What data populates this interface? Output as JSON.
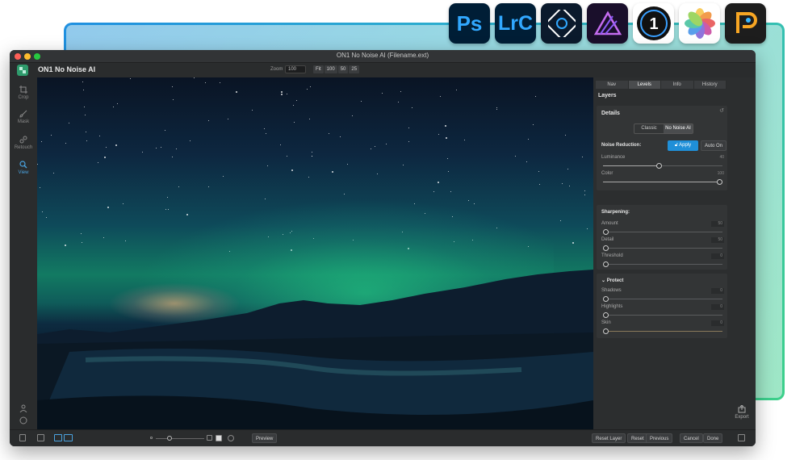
{
  "window": {
    "title": "ON1 No Noise AI (Filename.ext)",
    "app_name": "ON1 No Noise AI"
  },
  "host_apps": [
    {
      "name": "Photoshop",
      "label": "Ps"
    },
    {
      "name": "Lightroom Classic",
      "label": "LrC"
    },
    {
      "name": "Photoshop Elements",
      "label": ""
    },
    {
      "name": "Affinity Photo",
      "label": ""
    },
    {
      "name": "Capture One",
      "label": "1"
    },
    {
      "name": "Apple Photos",
      "label": ""
    },
    {
      "name": "PaintShop Pro",
      "label": ""
    }
  ],
  "toolbar": {
    "zoom_label": "Zoom",
    "zoom_value": "100",
    "zoom_buttons": [
      "Fit",
      "100",
      "50",
      "25"
    ]
  },
  "left_tools": [
    {
      "label": "Crop",
      "icon": "crop-icon"
    },
    {
      "label": "Mask",
      "icon": "brush-icon"
    },
    {
      "label": "Retouch",
      "icon": "retouch-icon"
    },
    {
      "label": "View",
      "icon": "view-icon",
      "active": true
    }
  ],
  "panel": {
    "tabs": [
      "Nav",
      "Levels",
      "Info",
      "History"
    ],
    "active_tab": "Levels",
    "layers_label": "Layers",
    "details": {
      "title": "Details",
      "modes": [
        "Classic",
        "No Noise AI"
      ],
      "selected_mode": "No Noise AI",
      "noise_reduction_label": "Noise Reduction:",
      "apply_label": "Apply",
      "auto_on_label": "Auto On",
      "sliders": [
        {
          "label": "Luminance",
          "value": "40",
          "fraction": 0.47
        },
        {
          "label": "Color",
          "value": "100",
          "fraction": 1.0
        }
      ]
    },
    "sharpening": {
      "title": "Sharpening:",
      "sliders": [
        {
          "label": "Amount",
          "value": "50",
          "fraction": 0.0
        },
        {
          "label": "Detail",
          "value": "50",
          "fraction": 0.0
        },
        {
          "label": "Threshold",
          "value": "0",
          "fraction": 0.0
        }
      ]
    },
    "protect": {
      "title": "Protect",
      "sliders": [
        {
          "label": "Shadows",
          "value": "0",
          "fraction": 0.0
        },
        {
          "label": "Highlights",
          "value": "0",
          "fraction": 0.0
        },
        {
          "label": "Skin",
          "value": "0",
          "fraction": 0.0
        }
      ]
    },
    "export_label": "Export"
  },
  "bottom": {
    "preview_label": "Preview",
    "reset_layer_label": "Reset Layer",
    "reset_label": "Reset",
    "previous_label": "Previous",
    "cancel_label": "Cancel",
    "done_label": "Done"
  },
  "colors": {
    "accent_blue": "#1f8fd8",
    "frame_start": "#1f8fe0",
    "frame_end": "#3cd08a"
  }
}
